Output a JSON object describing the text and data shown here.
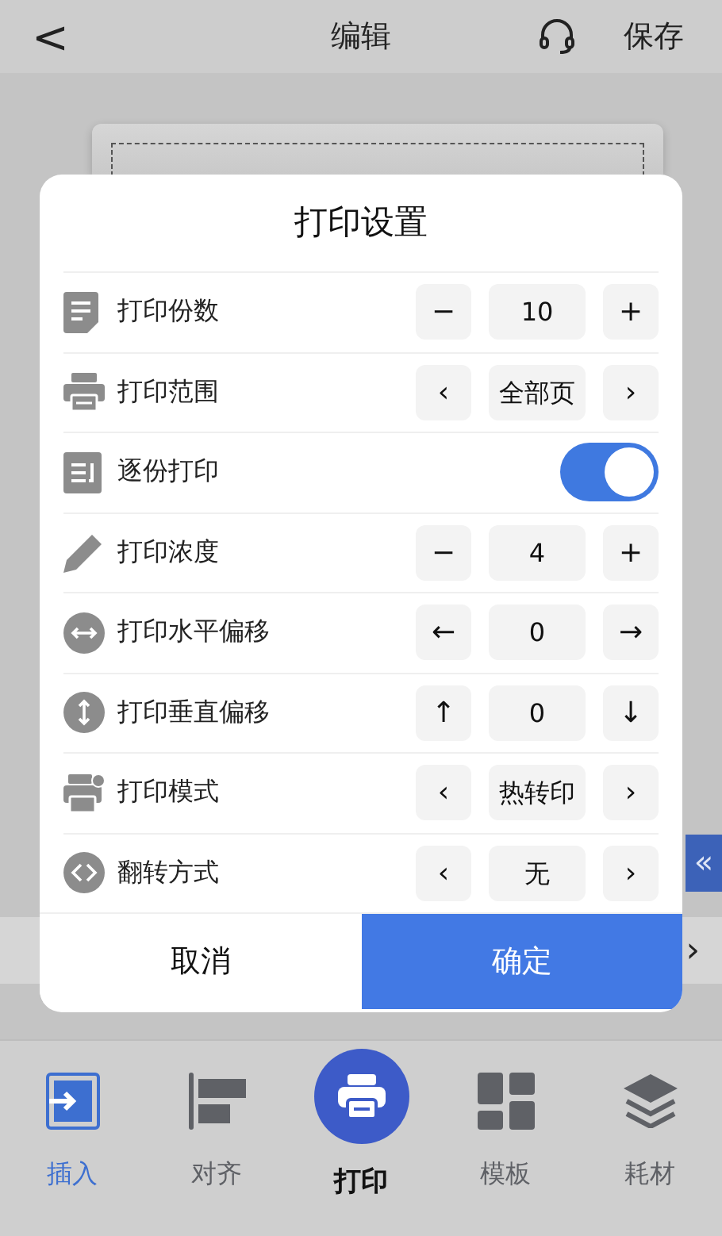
{
  "top_bar": {
    "back": "<",
    "title": "编辑",
    "save": "保存"
  },
  "side_handle": {
    "label": "«"
  },
  "canvas_toolbar": {
    "next": "›"
  },
  "dialog": {
    "title": "打印设置",
    "rows": [
      {
        "kind": "stepper",
        "label": "打印份数",
        "dec": "−",
        "value": "10",
        "inc": "+"
      },
      {
        "kind": "stepper",
        "label": "打印范围",
        "dec": "‹",
        "value": "全部页",
        "inc": "›"
      },
      {
        "kind": "toggle",
        "label": "逐份打印",
        "on": true
      },
      {
        "kind": "stepper",
        "label": "打印浓度",
        "dec": "−",
        "value": "4",
        "inc": "+"
      },
      {
        "kind": "stepper",
        "label": "打印水平偏移",
        "dec": "←",
        "value": "0",
        "inc": "→"
      },
      {
        "kind": "stepper",
        "label": "打印垂直偏移",
        "dec": "↑",
        "value": "0",
        "inc": "↓"
      },
      {
        "kind": "stepper",
        "label": "打印模式",
        "dec": "‹",
        "value": "热转印",
        "inc": "›"
      },
      {
        "kind": "stepper",
        "label": "翻转方式",
        "dec": "‹",
        "value": "无",
        "inc": "›"
      }
    ],
    "cancel": "取消",
    "confirm": "确定"
  },
  "tabs": [
    {
      "kind": "tab",
      "label": "插入",
      "selected": true
    },
    {
      "kind": "tab",
      "label": "对齐",
      "selected": false
    },
    {
      "kind": "primary",
      "label": "打印",
      "selected": false
    },
    {
      "kind": "tab",
      "label": "模板",
      "selected": false
    },
    {
      "kind": "tab",
      "label": "耗材",
      "selected": false
    }
  ]
}
